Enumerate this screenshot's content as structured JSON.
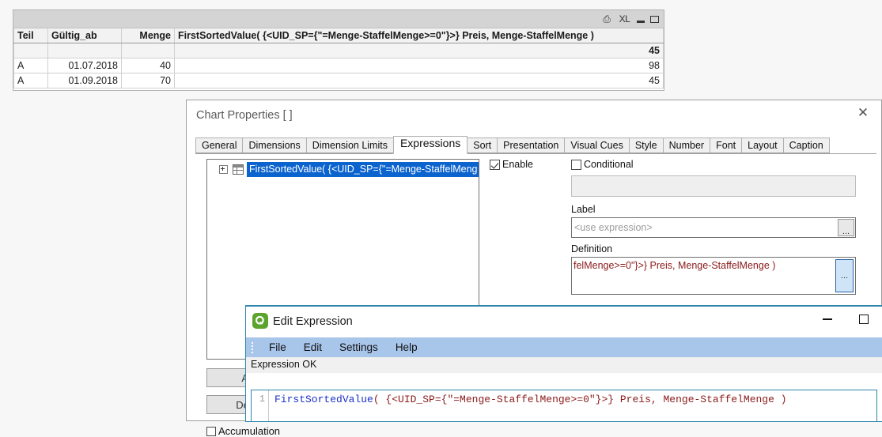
{
  "table_window": {
    "caption_buttons": [
      {
        "name": "print-export-icon",
        "label": "⎙"
      },
      {
        "name": "excel-export-icon",
        "label": "XL"
      },
      {
        "name": "minimize-icon",
        "label": ""
      },
      {
        "name": "maximize-icon",
        "label": ""
      }
    ],
    "columns": [
      "Teil",
      "Gültig_ab",
      "Menge",
      "FirstSortedValue(  {<UID_SP={\"=Menge-StaffelMenge>=0\"}>} Preis, Menge-StaffelMenge  )"
    ],
    "total_row": [
      "",
      "",
      "",
      "45"
    ],
    "rows": [
      [
        "A",
        "01.07.2018",
        "40",
        "98"
      ],
      [
        "A",
        "01.09.2018",
        "70",
        "45"
      ]
    ]
  },
  "chart_properties": {
    "title": "Chart Properties [ ]",
    "close_label": "✕",
    "tabs": [
      {
        "label": "General",
        "active": false
      },
      {
        "label": "Dimensions",
        "active": false
      },
      {
        "label": "Dimension Limits",
        "active": false
      },
      {
        "label": "Expressions",
        "active": true
      },
      {
        "label": "Sort",
        "active": false
      },
      {
        "label": "Presentation",
        "active": false
      },
      {
        "label": "Visual Cues",
        "active": false
      },
      {
        "label": "Style",
        "active": false
      },
      {
        "label": "Number",
        "active": false
      },
      {
        "label": "Font",
        "active": false
      },
      {
        "label": "Layout",
        "active": false
      },
      {
        "label": "Caption",
        "active": false
      }
    ],
    "expression_list": {
      "selected_item": "FirstSortedValue(  {<UID_SP={\"=Menge-StaffelMeng"
    },
    "enable": {
      "label": "Enable",
      "checked": true
    },
    "conditional": {
      "label": "Conditional",
      "checked": false,
      "value": ""
    },
    "label_field": {
      "caption": "Label",
      "placeholder": "<use expression>",
      "value": "",
      "browse_label": "..."
    },
    "definition_field": {
      "caption": "Definition",
      "value": "felMenge>=0\"}>} Preis, Menge-StaffelMenge  )",
      "browse_label": "..."
    },
    "buttons": {
      "add": "Add",
      "delete": "Delete"
    },
    "accumulation": {
      "label": "Accumulation",
      "checked": false
    }
  },
  "edit_expression": {
    "title": "Edit Expression",
    "app_icon": "qlikview-logo-icon",
    "window_buttons": [
      {
        "name": "minimize-button",
        "label": ""
      },
      {
        "name": "maximize-button",
        "label": ""
      }
    ],
    "menu": [
      "File",
      "Edit",
      "Settings",
      "Help"
    ],
    "status": "Expression OK",
    "editor": {
      "line_number": "1",
      "code_function": "FirstSortedValue",
      "code_rest": "( {<UID_SP={\"=Menge-StaffelMenge>=0\"}>} Preis, Menge-StaffelMenge )"
    }
  },
  "colors": {
    "accent_blue": "#0b63ce",
    "window_border_blue": "#2e86ab",
    "menubar_blue": "#a8c5ea",
    "expression_red": "#8b1a1a",
    "function_blue": "#1b31c8",
    "logo_green": "#5ba52e"
  }
}
